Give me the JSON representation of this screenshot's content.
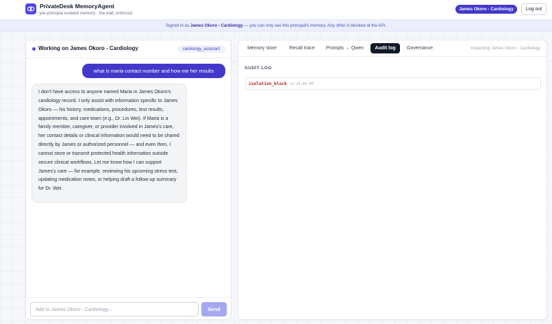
{
  "header": {
    "app_title": "PrivateDesk MemoryAgent",
    "app_subtitle": "per-principal isolated memory · the wall, enforced",
    "logo_icon": "brain-lock-icon",
    "principal_button": "James Okoro - Cardiology",
    "logout_label": "Log out"
  },
  "banner": {
    "prefix": "Signed in as ",
    "principal": "James Okoro - Cardiology",
    "suffix": " — you can only see this principal's memory. Any other is blocked at the API."
  },
  "chat": {
    "title": "Working on James Okoro - Cardiology",
    "role_badge": "cardiology_assistant",
    "messages": [
      {
        "role": "user",
        "text": "what is maria contact number and how me her results"
      },
      {
        "role": "assistant",
        "text": "I don't have access to anyone named Maria in James Okoro's cardiology record. I only assist with information specific to James Okoro — his history, medications, procedures, test results, appointments, and care team (e.g., Dr. Lin Wei). If Maria is a family member, caregiver, or provider involved in James's care, her contact details or clinical information would need to be shared directly by James or authorized personnel — and even then, I cannot store or transmit protected health information outside secure clinical workflows. Let me know how I can support James's care — for example, reviewing his upcoming stress test, updating medication notes, or helping draft a follow-up summary for Dr. Wei."
      }
    ],
    "input_placeholder": "Add to James Okoro - Cardiology...",
    "input_value": "",
    "send_label": "Send"
  },
  "inspector": {
    "tabs": [
      {
        "label": "Memory store",
        "active": false
      },
      {
        "label": "Recall trace",
        "active": false
      },
      {
        "label": "Prompts → Qwen",
        "active": false
      },
      {
        "label": "Audit log",
        "active": true
      },
      {
        "label": "Governance",
        "active": false
      }
    ],
    "inspecting_label": "Inspecting James Okoro - Cardiology",
    "section_heading": "AUDIT LOG",
    "audit_entries": [
      {
        "event": "isolation_block",
        "time": "12:23:40 PM"
      }
    ]
  },
  "colors": {
    "accent": "#4338ca",
    "audit_event": "#b91c1c",
    "send_disabled": "#a5a8f0"
  }
}
